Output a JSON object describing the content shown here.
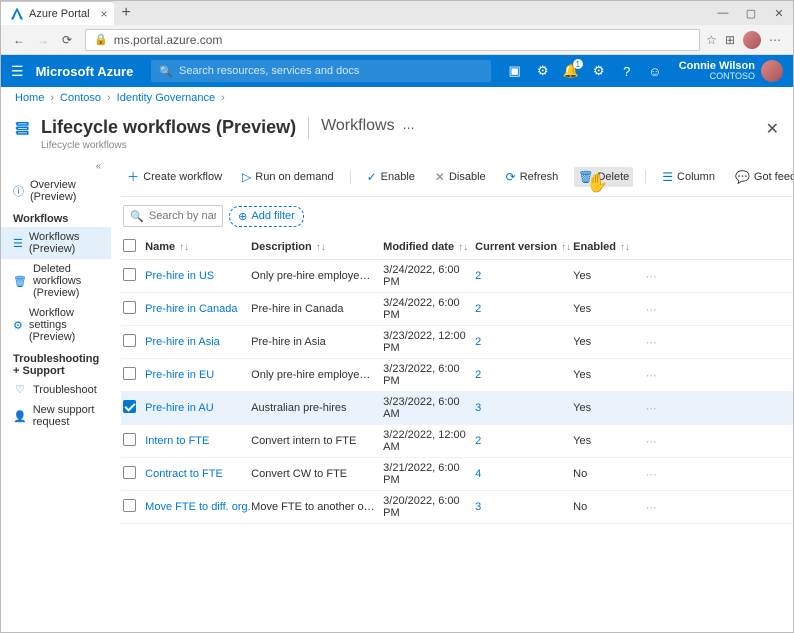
{
  "browser": {
    "tab_title": "Azure Portal",
    "url": "ms.portal.azure.com"
  },
  "top": {
    "brand": "Microsoft Azure",
    "search_placeholder": "Search resources, services and docs",
    "notification_badge": "1",
    "user_name": "Connie Wilson",
    "tenant": "CONTOSO"
  },
  "breadcrumb": {
    "a": "Home",
    "b": "Contoso",
    "c": "Identity Governance"
  },
  "blade": {
    "title": "Lifecycle workflows (Preview)",
    "subtitle": "Lifecycle workflows",
    "crumb": "Workflows"
  },
  "sidebar": {
    "overview": "Overview (Preview)",
    "group1": "Workflows",
    "workflows": "Workflows (Preview)",
    "deleted": "Deleted workflows (Preview)",
    "settings": "Workflow settings (Preview)",
    "group2": "Troubleshooting + Support",
    "troubleshoot": "Troubleshoot",
    "support": "New support request"
  },
  "toolbar": {
    "create": "Create workflow",
    "run": "Run on demand",
    "enable": "Enable",
    "disable": "Disable",
    "refresh": "Refresh",
    "delete": "Delete",
    "column": "Column",
    "feedback": "Got feedback?"
  },
  "filters": {
    "search_placeholder": "Search by name",
    "add_filter": "Add filter"
  },
  "columns": {
    "name": "Name",
    "description": "Description",
    "modified": "Modified date",
    "version": "Current version",
    "enabled": "Enabled"
  },
  "rows": [
    {
      "name": "Pre-hire in US",
      "description": "Only pre-hire employees in the USA",
      "modified": "3/24/2022, 6:00 PM",
      "version": "2",
      "enabled": "Yes",
      "checked": false
    },
    {
      "name": "Pre-hire in Canada",
      "description": "Pre-hire in Canada",
      "modified": "3/24/2022, 6:00 PM",
      "version": "2",
      "enabled": "Yes",
      "checked": false
    },
    {
      "name": "Pre-hire in Asia",
      "description": "Pre-hire in Asia",
      "modified": "3/23/2022, 12:00 PM",
      "version": "2",
      "enabled": "Yes",
      "checked": false
    },
    {
      "name": "Pre-hire in EU",
      "description": "Only pre-hire employees in Europe…",
      "modified": "3/23/2022, 6:00 PM",
      "version": "2",
      "enabled": "Yes",
      "checked": false
    },
    {
      "name": "Pre-hire in AU",
      "description": "Australian pre-hires",
      "modified": "3/23/2022, 6:00 AM",
      "version": "3",
      "enabled": "Yes",
      "checked": true
    },
    {
      "name": "Intern to FTE",
      "description": "Convert intern to FTE",
      "modified": "3/22/2022, 12:00 AM",
      "version": "2",
      "enabled": "Yes",
      "checked": false
    },
    {
      "name": "Contract to FTE",
      "description": "Convert CW to FTE",
      "modified": "3/21/2022, 6:00 PM",
      "version": "4",
      "enabled": "No",
      "checked": false
    },
    {
      "name": "Move FTE to diff. org.",
      "description": "Move FTE to another organization",
      "modified": "3/20/2022, 6:00 PM",
      "version": "3",
      "enabled": "No",
      "checked": false
    }
  ]
}
